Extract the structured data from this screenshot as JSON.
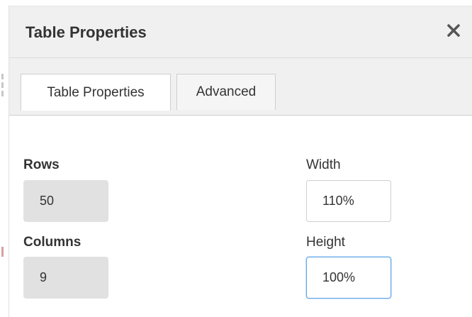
{
  "dialog": {
    "title": "Table Properties",
    "close_icon": "close-icon",
    "tabs": [
      {
        "label": "Table Properties",
        "active": true
      },
      {
        "label": "Advanced",
        "active": false
      }
    ]
  },
  "form": {
    "rows": {
      "label": "Rows",
      "value": "50"
    },
    "columns": {
      "label": "Columns",
      "value": "9"
    },
    "width": {
      "label": "Width",
      "value": "110%"
    },
    "height": {
      "label": "Height",
      "value": "100%"
    }
  },
  "colors": {
    "header_bg": "#f0f0f0",
    "readonly_field_bg": "#e1e1e1",
    "focus_border": "#62a8ea",
    "text": "#333333"
  }
}
